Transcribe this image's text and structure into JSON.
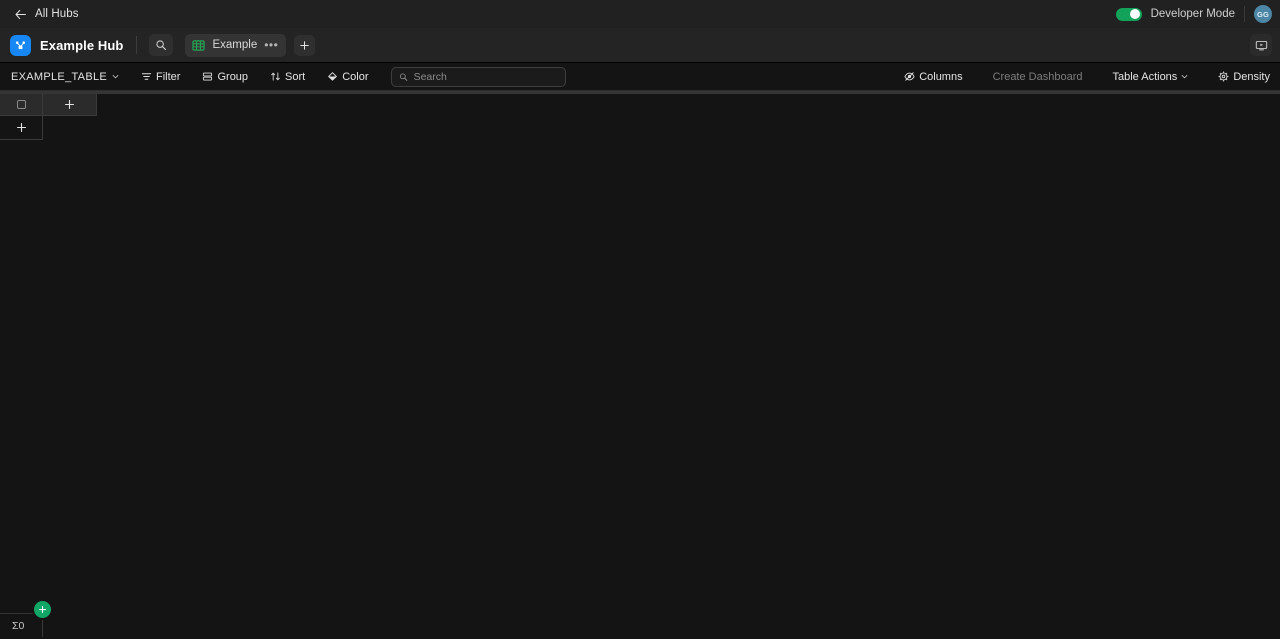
{
  "topbar": {
    "back_label": "All Hubs",
    "back_icon": "arrow-left-icon",
    "developer_mode_label": "Developer Mode",
    "developer_mode_on": true,
    "avatar_initials": "GG",
    "avatar_color": "#4c86a4",
    "toggle_color": "#13a25a"
  },
  "hubbar": {
    "logo_icon": "hub-logo-icon",
    "logo_color": "#1787f5",
    "hub_title": "Example Hub",
    "search_icon": "search-icon",
    "tab": {
      "icon": "table-grid-icon",
      "icon_color": "#23b259",
      "label": "Example",
      "menu_glyph": "•••"
    },
    "add_tab_glyph": "+",
    "present_icon": "present-monitor-icon"
  },
  "toolbar": {
    "table_name": "EXAMPLE_TABLE",
    "table_name_caret": "chevron-down-icon",
    "filter_label": "Filter",
    "filter_icon": "filter-icon",
    "group_label": "Group",
    "group_icon": "group-rows-icon",
    "sort_label": "Sort",
    "sort_icon": "sort-arrows-icon",
    "color_label": "Color",
    "color_icon": "color-droplet-icon",
    "search_placeholder": "Search",
    "search_value": "",
    "search_icon": "search-icon",
    "columns_label": "Columns",
    "columns_icon": "eye-slash-icon",
    "create_dashboard_label": "Create Dashboard",
    "create_dashboard_disabled": true,
    "table_actions_label": "Table Actions",
    "table_actions_caret": "chevron-down-icon",
    "density_label": "Density",
    "density_icon": "gear-icon"
  },
  "grid": {
    "select_all_checkbox": "checkbox-icon",
    "add_column_glyph": "+",
    "add_row_glyph": "+",
    "rows": []
  },
  "footer": {
    "add_record_glyph": "+",
    "add_record_color": "#11a566",
    "summary_value": "Σ0"
  }
}
